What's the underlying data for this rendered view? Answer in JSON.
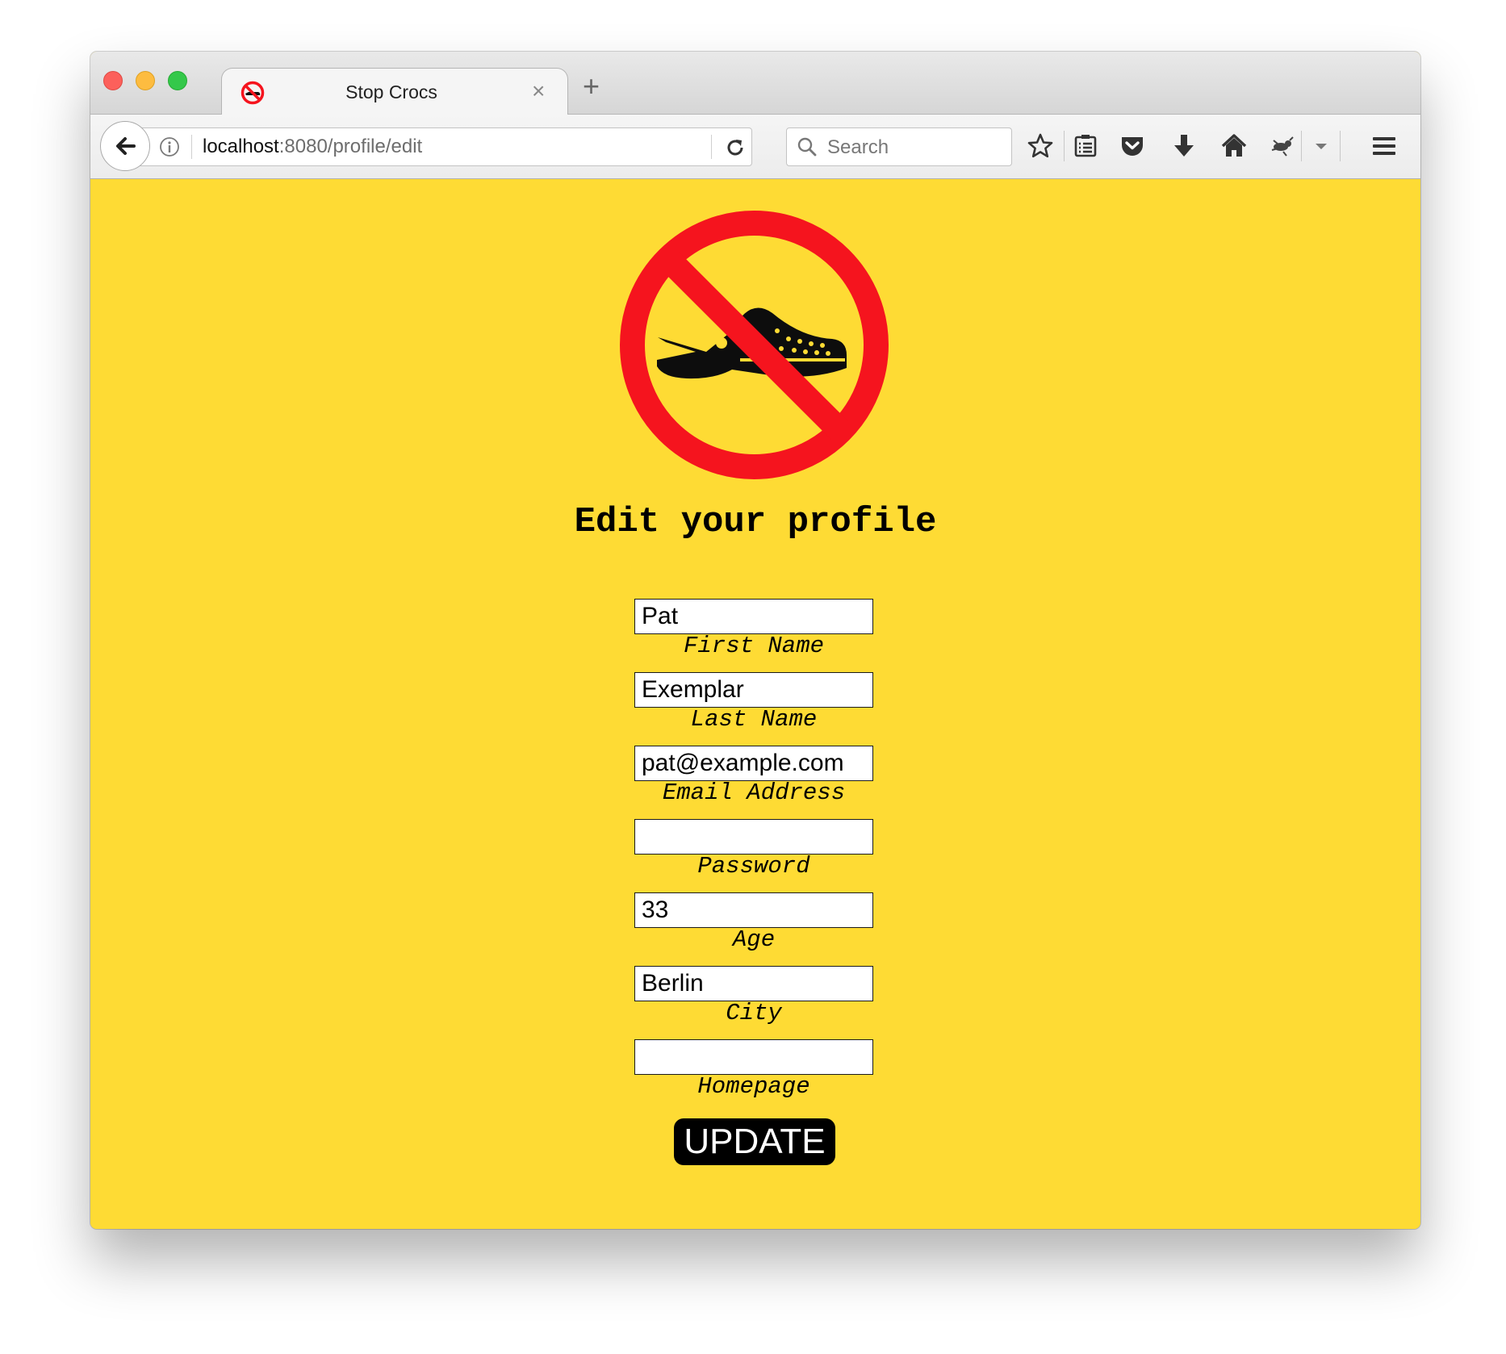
{
  "browser": {
    "tab_title": "Stop Crocs",
    "tab_close": "×",
    "new_tab": "+",
    "url_host": "localhost",
    "url_rest": ":8080/profile/edit",
    "search_placeholder": "Search"
  },
  "icons": [
    "back-arrow-icon",
    "info-icon",
    "reload-icon",
    "search-icon",
    "bookmark-star-icon",
    "reading-list-icon",
    "pocket-icon",
    "download-icon",
    "home-icon",
    "extension-icon",
    "menu-icon"
  ],
  "colors": {
    "page_background": "#fedb34",
    "no_sign_red": "#f5141e",
    "button_background": "#000000",
    "button_text": "#ffffff"
  },
  "page": {
    "logo_alt": "no crocs sign",
    "heading": "Edit your profile",
    "fields": [
      {
        "label": "First Name",
        "value": "Pat"
      },
      {
        "label": "Last Name",
        "value": "Exemplar"
      },
      {
        "label": "Email Address",
        "value": "pat@example.com"
      },
      {
        "label": "Password",
        "value": ""
      },
      {
        "label": "Age",
        "value": "33"
      },
      {
        "label": "City",
        "value": "Berlin"
      },
      {
        "label": "Homepage",
        "value": ""
      }
    ],
    "submit_label": "UPDATE"
  }
}
